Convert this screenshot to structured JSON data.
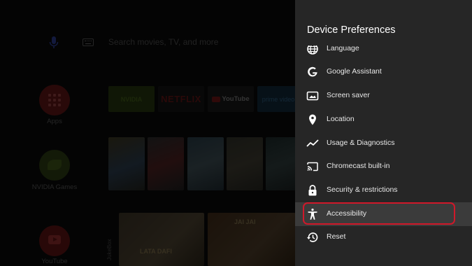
{
  "home": {
    "search_text": "Search movies, TV, and more",
    "side_apps": [
      {
        "label": "Apps",
        "icon": "apps-grid-icon"
      },
      {
        "label": "NVIDIA Games",
        "icon": "nvidia-icon"
      },
      {
        "label": "YouTube",
        "icon": "youtube-icon"
      }
    ],
    "app_tiles": [
      {
        "label": "NVIDIA"
      },
      {
        "label": "NETFLIX"
      },
      {
        "label": "YouTube"
      },
      {
        "label": "prime video"
      }
    ],
    "video_tiles": [
      {
        "title": "LATA DAFI"
      },
      {
        "title": "JAI JAI"
      }
    ],
    "side_text": "JukeBox"
  },
  "panel": {
    "title": "Device Preferences",
    "items": [
      {
        "label": "Language",
        "icon": "globe-icon"
      },
      {
        "label": "Google Assistant",
        "icon": "google-icon"
      },
      {
        "label": "Screen saver",
        "icon": "screen-saver-icon"
      },
      {
        "label": "Location",
        "icon": "location-pin-icon"
      },
      {
        "label": "Usage & Diagnostics",
        "icon": "trending-icon"
      },
      {
        "label": "Chromecast built-in",
        "icon": "cast-icon"
      },
      {
        "label": "Security & restrictions",
        "icon": "lock-icon"
      },
      {
        "label": "Accessibility",
        "icon": "accessibility-icon",
        "selected": true
      },
      {
        "label": "Reset",
        "icon": "restore-icon"
      }
    ]
  },
  "colors": {
    "panel_bg": "#262626",
    "selected_bg": "#3b3b3b",
    "highlight_ring": "#d0182a"
  }
}
